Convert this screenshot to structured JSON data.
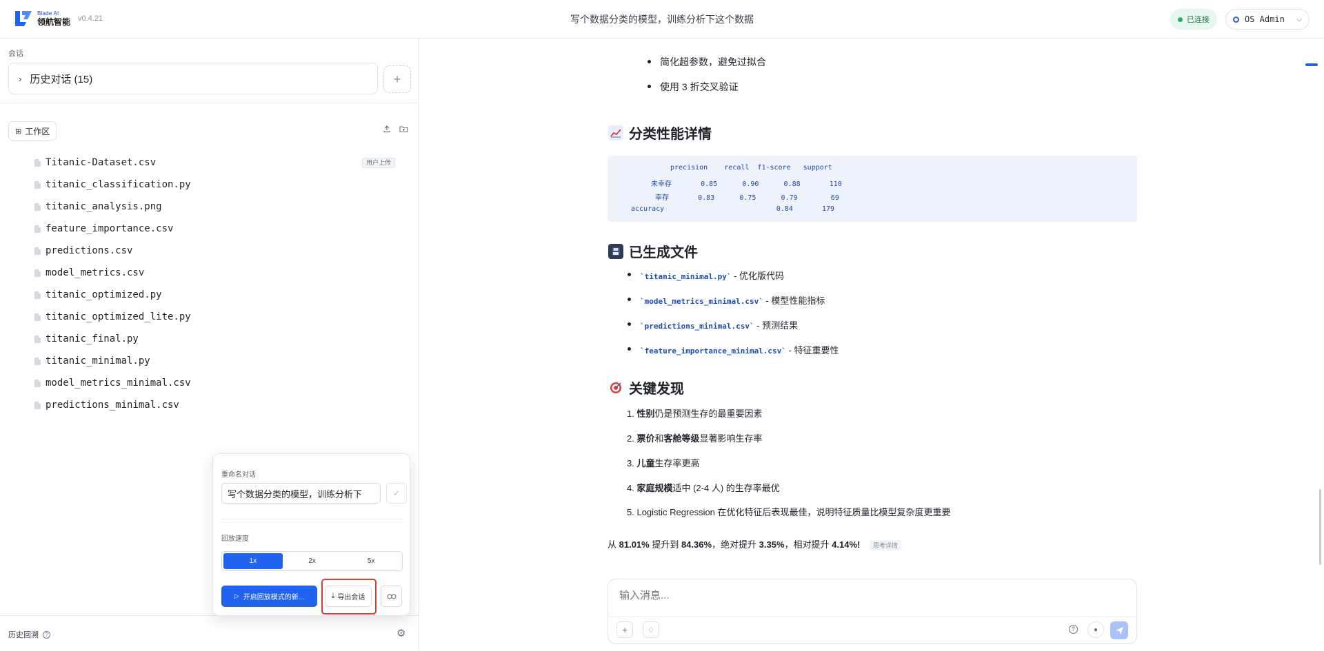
{
  "header": {
    "logo_small": "Blade AI",
    "logo_big": "领航智能",
    "version": "v0.4.21",
    "title": "写个数据分类的模型，训练分析下这个数据",
    "status": "已连接",
    "user": "OS Admin"
  },
  "sidebar": {
    "session_label": "会话",
    "history_label": "历史对话 (15)",
    "workspace_label": "工作区",
    "files": [
      {
        "name": "Titanic-Dataset.csv",
        "badge": "用户上传"
      },
      {
        "name": "titanic_classification.py"
      },
      {
        "name": "titanic_analysis.png"
      },
      {
        "name": "feature_importance.csv"
      },
      {
        "name": "predictions.csv"
      },
      {
        "name": "model_metrics.csv"
      },
      {
        "name": "titanic_optimized.py"
      },
      {
        "name": "titanic_optimized_lite.py"
      },
      {
        "name": "titanic_final.py"
      },
      {
        "name": "titanic_minimal.py"
      },
      {
        "name": "model_metrics_minimal.csv"
      },
      {
        "name": "predictions_minimal.csv"
      }
    ],
    "footer_label": "历史回溯"
  },
  "popover": {
    "rename_label": "重命名对话",
    "rename_value": "写个数据分类的模型，训练分析下",
    "speed_label": "回放速度",
    "speeds": [
      "1x",
      "2x",
      "5x"
    ],
    "active_speed": "1x",
    "replay_label": "开启回放模式的新...",
    "export_label": "导出会话"
  },
  "content": {
    "bullets_top": [
      "简化超参数，避免过拟合",
      "使用 3 折交叉验证"
    ],
    "section_perf": "分类性能详情",
    "report": {
      "header": "precision    recall  f1-score   support",
      "rows": [
        "未幸存       0.85      0.90      0.88       110",
        "幸存       0.83      0.75      0.79        69",
        "accuracy                           0.84       179"
      ]
    },
    "section_files": "已生成文件",
    "generated": [
      {
        "code": "`titanic_minimal.py`",
        "desc": " - 优化版代码"
      },
      {
        "code": "`model_metrics_minimal.csv`",
        "desc": " - 模型性能指标"
      },
      {
        "code": "`predictions_minimal.csv`",
        "desc": " - 预测结果"
      },
      {
        "code": "`feature_importance_minimal.csv`",
        "desc": " - 特征重要性"
      }
    ],
    "section_findings": "关键发现",
    "findings": [
      {
        "num": "1.",
        "bold": "性别",
        "rest": "仍是预测生存的最重要因素"
      },
      {
        "num": "2.",
        "bold": "票价",
        "mid": "和",
        "bold2": "客舱等级",
        "rest": "显著影响生存率"
      },
      {
        "num": "3.",
        "bold": "儿童",
        "rest": "生存率更高"
      },
      {
        "num": "4.",
        "bold": "家庭规模",
        "rest": "适中 (2-4 人) 的生存率最优"
      },
      {
        "num": "5.",
        "bold": "",
        "rest": "Logistic Regression 在优化特征后表现最佳，说明特征质量比模型复杂度更重要"
      }
    ],
    "summary": {
      "p1": "从 ",
      "v1": "81.01%",
      "p2": " 提升到 ",
      "v2": "84.36%",
      "p3": "，绝对提升 ",
      "v3": "3.35%",
      "p4": "，相对提升 ",
      "v4": "4.14%",
      "p5": "!",
      "tag": "思考详情"
    },
    "composer_placeholder": "输入消息..."
  },
  "colors": {
    "accent": "#1f63f0",
    "highlight": "#d93a3a",
    "status_green": "#22b35e"
  }
}
